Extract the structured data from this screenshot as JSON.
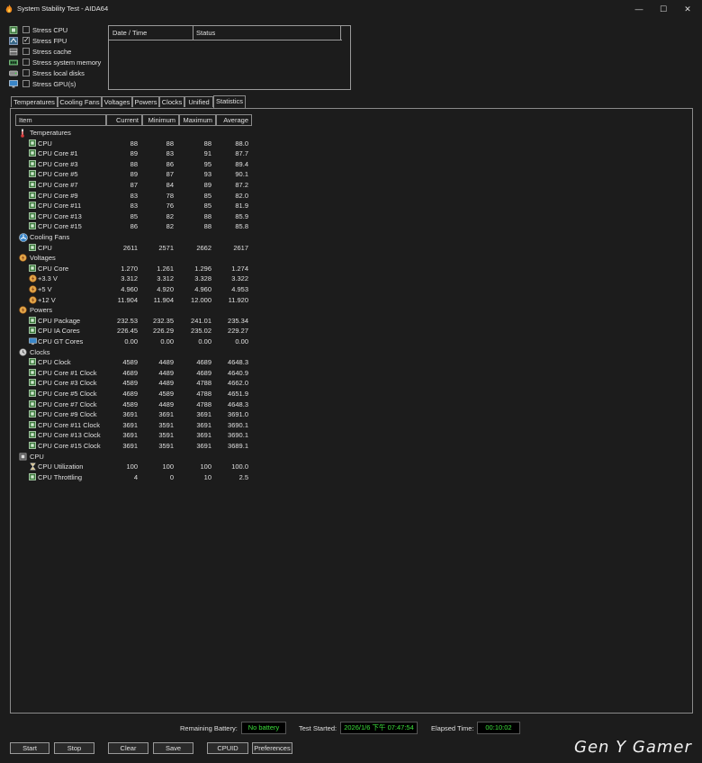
{
  "window": {
    "title": "System Stability Test - AIDA64",
    "minimize": "—",
    "maximize": "☐",
    "close": "✕"
  },
  "stress": [
    {
      "label": "Stress CPU",
      "checked": false,
      "icon": "cpu-icon"
    },
    {
      "label": "Stress FPU",
      "checked": true,
      "icon": "fpu-icon"
    },
    {
      "label": "Stress cache",
      "checked": false,
      "icon": "cache-icon"
    },
    {
      "label": "Stress system memory",
      "checked": false,
      "icon": "memory-icon"
    },
    {
      "label": "Stress local disks",
      "checked": false,
      "icon": "disk-icon"
    },
    {
      "label": "Stress GPU(s)",
      "checked": false,
      "icon": "monitor-icon"
    }
  ],
  "log": {
    "col_date": "Date / Time",
    "col_status": "Status"
  },
  "tabs": [
    "Temperatures",
    "Cooling Fans",
    "Voltages",
    "Powers",
    "Clocks",
    "Unified",
    "Statistics"
  ],
  "active_tab": "Statistics",
  "grid": {
    "headers": [
      "Item",
      "Current",
      "Minimum",
      "Maximum",
      "Average"
    ],
    "rows": [
      {
        "type": "group",
        "icon": "thermometer-icon",
        "name": "Temperatures"
      },
      {
        "type": "item",
        "name": "CPU",
        "current": "88",
        "min": "88",
        "max": "88",
        "avg": "88.0"
      },
      {
        "type": "item",
        "name": "CPU Core #1",
        "current": "89",
        "min": "83",
        "max": "91",
        "avg": "87.7"
      },
      {
        "type": "item",
        "name": "CPU Core #3",
        "current": "88",
        "min": "86",
        "max": "95",
        "avg": "89.4"
      },
      {
        "type": "item",
        "name": "CPU Core #5",
        "current": "89",
        "min": "87",
        "max": "93",
        "avg": "90.1"
      },
      {
        "type": "item",
        "name": "CPU Core #7",
        "current": "87",
        "min": "84",
        "max": "89",
        "avg": "87.2"
      },
      {
        "type": "item",
        "name": "CPU Core #9",
        "current": "83",
        "min": "78",
        "max": "85",
        "avg": "82.0"
      },
      {
        "type": "item",
        "name": "CPU Core #11",
        "current": "83",
        "min": "76",
        "max": "85",
        "avg": "81.9"
      },
      {
        "type": "item",
        "name": "CPU Core #13",
        "current": "85",
        "min": "82",
        "max": "88",
        "avg": "85.9"
      },
      {
        "type": "item",
        "name": "CPU Core #15",
        "current": "86",
        "min": "82",
        "max": "88",
        "avg": "85.8"
      },
      {
        "type": "group",
        "icon": "fan-icon",
        "name": "Cooling Fans"
      },
      {
        "type": "item",
        "name": "CPU",
        "current": "2611",
        "min": "2571",
        "max": "2662",
        "avg": "2617"
      },
      {
        "type": "group",
        "icon": "voltage-icon",
        "name": "Voltages"
      },
      {
        "type": "item",
        "name": "CPU Core",
        "current": "1.270",
        "min": "1.261",
        "max": "1.296",
        "avg": "1.274"
      },
      {
        "type": "item",
        "itemicon": "voltage-icon",
        "name": "+3.3 V",
        "current": "3.312",
        "min": "3.312",
        "max": "3.328",
        "avg": "3.322"
      },
      {
        "type": "item",
        "itemicon": "voltage-icon",
        "name": "+5 V",
        "current": "4.960",
        "min": "4.920",
        "max": "4.960",
        "avg": "4.953"
      },
      {
        "type": "item",
        "itemicon": "voltage-icon",
        "name": "+12 V",
        "current": "11.904",
        "min": "11.904",
        "max": "12.000",
        "avg": "11.920"
      },
      {
        "type": "group",
        "icon": "power-icon",
        "name": "Powers"
      },
      {
        "type": "item",
        "name": "CPU Package",
        "current": "232.53",
        "min": "232.35",
        "max": "241.01",
        "avg": "235.34"
      },
      {
        "type": "item",
        "name": "CPU IA Cores",
        "current": "226.45",
        "min": "226.29",
        "max": "235.02",
        "avg": "229.27"
      },
      {
        "type": "item",
        "itemicon": "monitor-icon",
        "name": "CPU GT Cores",
        "current": "0.00",
        "min": "0.00",
        "max": "0.00",
        "avg": "0.00"
      },
      {
        "type": "group",
        "icon": "clock-icon",
        "name": "Clocks"
      },
      {
        "type": "item",
        "name": "CPU Clock",
        "current": "4589",
        "min": "4489",
        "max": "4689",
        "avg": "4648.3"
      },
      {
        "type": "item",
        "name": "CPU Core #1 Clock",
        "current": "4689",
        "min": "4489",
        "max": "4689",
        "avg": "4640.9"
      },
      {
        "type": "item",
        "name": "CPU Core #3 Clock",
        "current": "4589",
        "min": "4489",
        "max": "4788",
        "avg": "4662.0"
      },
      {
        "type": "item",
        "name": "CPU Core #5 Clock",
        "current": "4689",
        "min": "4589",
        "max": "4788",
        "avg": "4651.9"
      },
      {
        "type": "item",
        "name": "CPU Core #7 Clock",
        "current": "4589",
        "min": "4489",
        "max": "4788",
        "avg": "4648.3"
      },
      {
        "type": "item",
        "name": "CPU Core #9 Clock",
        "current": "3691",
        "min": "3691",
        "max": "3691",
        "avg": "3691.0"
      },
      {
        "type": "item",
        "name": "CPU Core #11 Clock",
        "current": "3691",
        "min": "3591",
        "max": "3691",
        "avg": "3690.1"
      },
      {
        "type": "item",
        "name": "CPU Core #13 Clock",
        "current": "3691",
        "min": "3591",
        "max": "3691",
        "avg": "3690.1"
      },
      {
        "type": "item",
        "name": "CPU Core #15 Clock",
        "current": "3691",
        "min": "3591",
        "max": "3691",
        "avg": "3689.1"
      },
      {
        "type": "group",
        "icon": "cpu-icon",
        "name": "CPU"
      },
      {
        "type": "item",
        "itemicon": "hourglass-icon",
        "name": "CPU Utilization",
        "current": "100",
        "min": "100",
        "max": "100",
        "avg": "100.0"
      },
      {
        "type": "item",
        "name": "CPU Throttling",
        "current": "4",
        "min": "0",
        "max": "10",
        "avg": "2.5"
      }
    ]
  },
  "status": {
    "battery_label": "Remaining Battery:",
    "battery_value": "No battery",
    "started_label": "Test Started:",
    "started_value": "2026/1/6 下午 07:47:54",
    "elapsed_label": "Elapsed Time:",
    "elapsed_value": "00:10:02"
  },
  "buttons": {
    "start": "Start",
    "stop": "Stop",
    "clear": "Clear",
    "save": "Save",
    "cpuid": "CPUID",
    "preferences": "Preferences"
  },
  "watermark": "Gen Y Gamer",
  "colors": {
    "background": "#1c1c1c",
    "status_green": "#3ce03c",
    "chip_green": "#3c7a3c"
  }
}
